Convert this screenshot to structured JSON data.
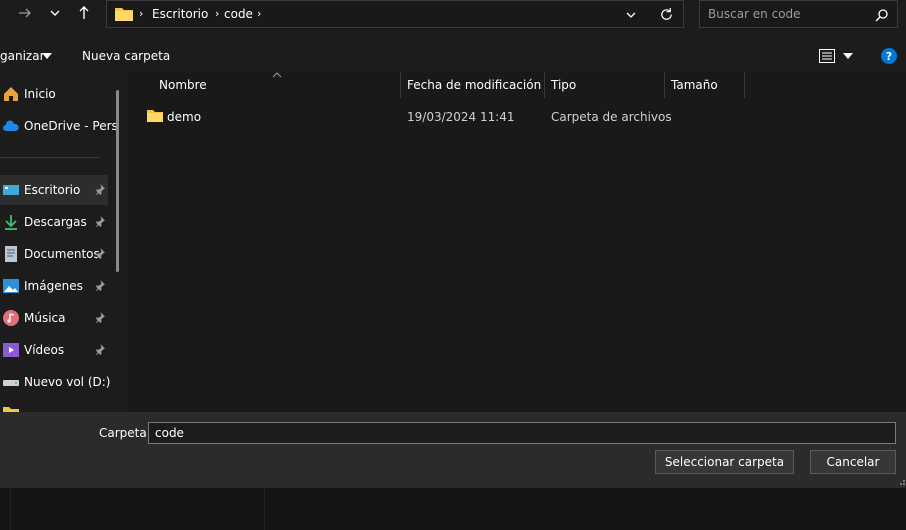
{
  "address": {
    "crumbs": [
      "Escritorio",
      "code"
    ]
  },
  "search": {
    "placeholder": "Buscar en code"
  },
  "toolbar": {
    "organize_label": "ganizar",
    "new_folder_label": "Nueva carpeta"
  },
  "sidebar": {
    "items": [
      {
        "label": "Inicio",
        "icon": "home-icon",
        "pinned": false
      },
      {
        "label": "OneDrive - Perso",
        "icon": "onedrive-cloud-icon",
        "pinned": false
      },
      {
        "label": "Escritorio",
        "icon": "desktop-icon",
        "pinned": true
      },
      {
        "label": "Descargas",
        "icon": "download-icon",
        "pinned": true
      },
      {
        "label": "Documentos",
        "icon": "document-icon",
        "pinned": true
      },
      {
        "label": "Imágenes",
        "icon": "pictures-icon",
        "pinned": true
      },
      {
        "label": "Música",
        "icon": "music-icon",
        "pinned": true
      },
      {
        "label": "Vídeos",
        "icon": "videos-icon",
        "pinned": true
      },
      {
        "label": "Nuevo vol (D:)",
        "icon": "drive-icon",
        "pinned": false
      }
    ]
  },
  "columns": {
    "name": "Nombre",
    "modified": "Fecha de modificación",
    "type": "Tipo",
    "size": "Tamaño"
  },
  "files": [
    {
      "name": "demo",
      "modified": "19/03/2024 11:41",
      "type": "Carpeta de archivos",
      "size": ""
    }
  ],
  "footer": {
    "folder_label": "Carpeta:",
    "folder_value": "code",
    "select_button": "Seleccionar carpeta",
    "cancel_button": "Cancelar"
  },
  "colors": {
    "accent": "#0078d4",
    "folder": "#f4c542",
    "selected": "#2d2d2d"
  }
}
